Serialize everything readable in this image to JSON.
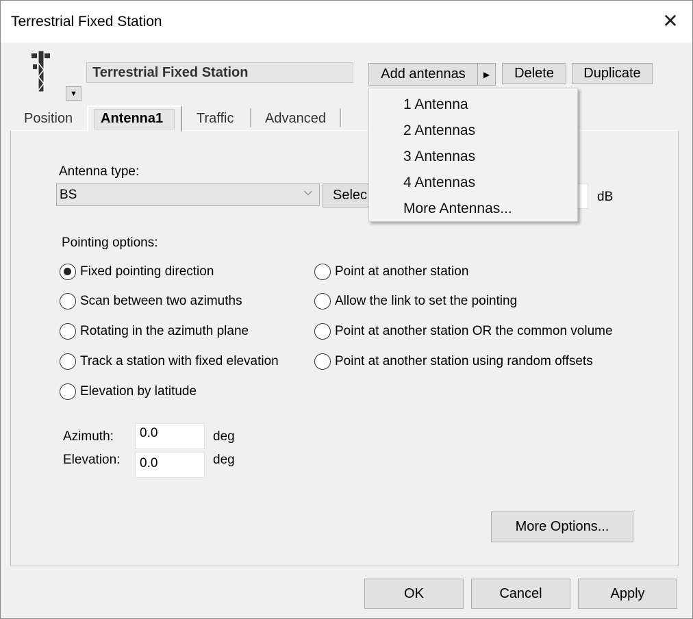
{
  "window": {
    "title": "Terrestrial Fixed Station"
  },
  "header": {
    "icon": "radio-tower-icon",
    "station_name": "Terrestrial Fixed Station",
    "add_antennas": "Add antennas",
    "delete": "Delete",
    "duplicate": "Duplicate"
  },
  "tabs": [
    {
      "label": "Position"
    },
    {
      "label": "Antenna1",
      "selected": true
    },
    {
      "label": "Traffic"
    },
    {
      "label": "Advanced"
    }
  ],
  "antenna": {
    "type_label": "Antenna type:",
    "type_value": "BS",
    "select_label": "Selec",
    "gain_unit": "dB"
  },
  "pointing": {
    "label": "Pointing options:",
    "options": [
      {
        "label": "Fixed pointing direction",
        "selected": true
      },
      {
        "label": "Scan between two azimuths"
      },
      {
        "label": "Rotating in the azimuth plane"
      },
      {
        "label": "Track a station with fixed elevation"
      },
      {
        "label": "Elevation by latitude"
      },
      {
        "label": "Point at another station"
      },
      {
        "label": "Allow the link to set the pointing"
      },
      {
        "label": "Point at another station OR the common volume"
      },
      {
        "label": "Point at another station using random offsets"
      }
    ]
  },
  "azimuth": {
    "label": "Azimuth:",
    "value": "0.0",
    "unit": "deg"
  },
  "elevation": {
    "label": "Elevation:",
    "value": "0.0",
    "unit": "deg"
  },
  "more_options": "More Options...",
  "footer": {
    "ok": "OK",
    "cancel": "Cancel",
    "apply": "Apply"
  },
  "menu": {
    "items": [
      "1 Antenna",
      "2 Antennas",
      "3 Antennas",
      "4 Antennas",
      "More Antennas..."
    ]
  }
}
